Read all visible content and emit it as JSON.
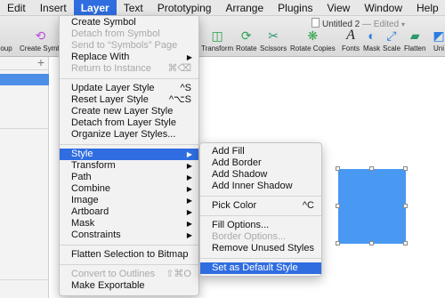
{
  "menubar": [
    "Edit",
    "Insert",
    "Layer",
    "Text",
    "Prototyping",
    "Arrange",
    "Plugins",
    "View",
    "Window",
    "Help"
  ],
  "toolbar": {
    "left_label": "oup",
    "create_symbol": "Create Symb",
    "doc_title": "Untitled 2",
    "doc_status": "— Edited",
    "buttons": [
      "Transform",
      "Rotate",
      "Scissors",
      "Rotate Copies",
      "Fonts",
      "Mask",
      "Scale",
      "Flatten",
      "Uni"
    ],
    "icons": [
      "transform-icon",
      "rotate-icon",
      "scissors-icon",
      "rotate-copies-icon",
      "fonts-icon",
      "mask-icon",
      "scale-icon",
      "flatten-icon",
      "union-icon"
    ]
  },
  "layer_menu": {
    "groups": [
      [
        {
          "label": "Create Symbol",
          "shortcut": "",
          "disabled": false,
          "submenu": false
        },
        {
          "label": "Detach from Symbol",
          "shortcut": "",
          "disabled": true,
          "submenu": false
        },
        {
          "label": "Send to “Symbols” Page",
          "shortcut": "",
          "disabled": true,
          "submenu": false
        },
        {
          "label": "Replace With",
          "shortcut": "",
          "disabled": false,
          "submenu": true
        },
        {
          "label": "Return to Instance",
          "shortcut": "⌘⌫",
          "disabled": true,
          "submenu": false
        }
      ],
      [
        {
          "label": "Update Layer Style",
          "shortcut": "^S",
          "disabled": false,
          "submenu": false
        },
        {
          "label": "Reset Layer Style",
          "shortcut": "^⌥S",
          "disabled": false,
          "submenu": false
        },
        {
          "label": "Create new Layer Style",
          "shortcut": "",
          "disabled": false,
          "submenu": false
        },
        {
          "label": "Detach from Layer Style",
          "shortcut": "",
          "disabled": false,
          "submenu": false
        },
        {
          "label": "Organize Layer Styles...",
          "shortcut": "",
          "disabled": false,
          "submenu": false
        }
      ],
      [
        {
          "label": "Style",
          "shortcut": "",
          "disabled": false,
          "submenu": true,
          "highlighted": true
        },
        {
          "label": "Transform",
          "shortcut": "",
          "disabled": false,
          "submenu": true
        },
        {
          "label": "Path",
          "shortcut": "",
          "disabled": false,
          "submenu": true
        },
        {
          "label": "Combine",
          "shortcut": "",
          "disabled": false,
          "submenu": true
        },
        {
          "label": "Image",
          "shortcut": "",
          "disabled": false,
          "submenu": true
        },
        {
          "label": "Artboard",
          "shortcut": "",
          "disabled": false,
          "submenu": true
        },
        {
          "label": "Mask",
          "shortcut": "",
          "disabled": false,
          "submenu": true
        },
        {
          "label": "Constraints",
          "shortcut": "",
          "disabled": false,
          "submenu": true
        }
      ],
      [
        {
          "label": "Flatten Selection to Bitmap",
          "shortcut": "",
          "disabled": false,
          "submenu": false
        }
      ],
      [
        {
          "label": "Convert to Outlines",
          "shortcut": "⇧⌘O",
          "disabled": true,
          "submenu": false
        },
        {
          "label": "Make Exportable",
          "shortcut": "",
          "disabled": false,
          "submenu": false
        }
      ]
    ]
  },
  "style_submenu": {
    "groups": [
      [
        {
          "label": "Add Fill",
          "shortcut": "",
          "disabled": false
        },
        {
          "label": "Add Border",
          "shortcut": "",
          "disabled": false
        },
        {
          "label": "Add Shadow",
          "shortcut": "",
          "disabled": false
        },
        {
          "label": "Add Inner Shadow",
          "shortcut": "",
          "disabled": false
        }
      ],
      [
        {
          "label": "Pick Color",
          "shortcut": "^C",
          "disabled": false
        }
      ],
      [
        {
          "label": "Fill Options...",
          "shortcut": "",
          "disabled": false
        },
        {
          "label": "Border Options...",
          "shortcut": "",
          "disabled": true
        },
        {
          "label": "Remove Unused Styles",
          "shortcut": "",
          "disabled": false
        }
      ],
      [
        {
          "label": "Set as Default Style",
          "shortcut": "",
          "disabled": false,
          "highlighted": true
        }
      ]
    ]
  },
  "colors": {
    "menu_highlight": "#2f6de1",
    "shape_fill": "#4998f2",
    "sidebar_selection": "#4d8fe8"
  }
}
